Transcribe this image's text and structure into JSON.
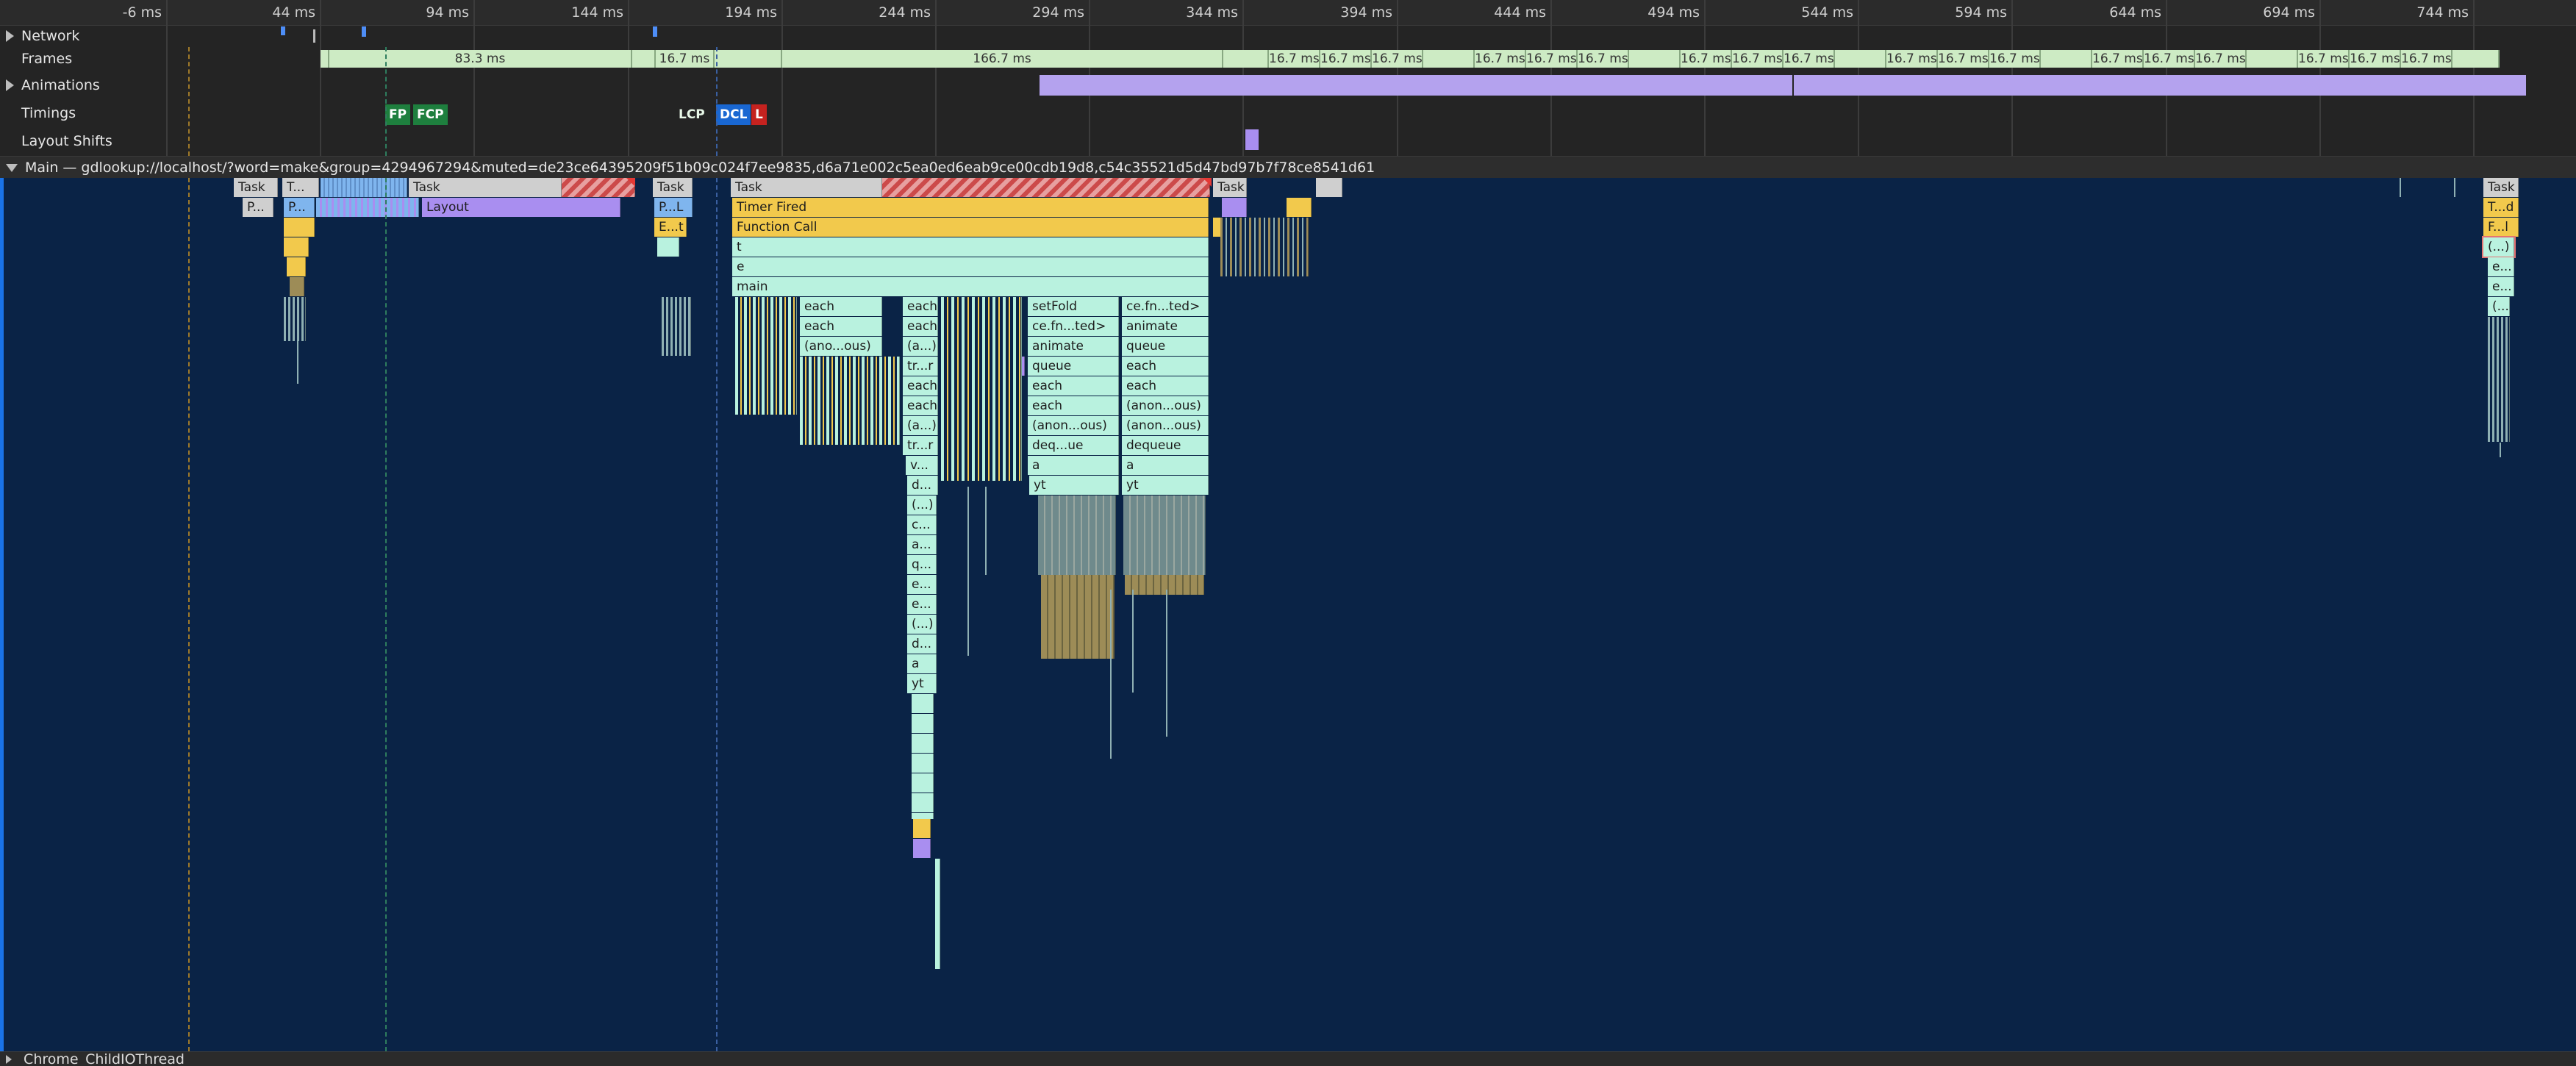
{
  "ruler": {
    "ticks": [
      "-6 ms",
      "44 ms",
      "94 ms",
      "144 ms",
      "194 ms",
      "244 ms",
      "294 ms",
      "344 ms",
      "394 ms",
      "444 ms",
      "494 ms",
      "544 ms",
      "594 ms",
      "644 ms",
      "694 ms",
      "744 ms"
    ]
  },
  "tracks": {
    "network": "Network",
    "frames": "Frames",
    "animations": "Animations",
    "timings": "Timings",
    "layout_shifts": "Layout Shifts"
  },
  "frames": {
    "labels": [
      "83.3 ms",
      "16.7 ms",
      "166.7 ms",
      "16.7 ms",
      "16.7 ms",
      "16.7 ms",
      "16.7 ms",
      "16.7 ms",
      "16.7 ms",
      "16.7 ms",
      "16.7 ms",
      "16.7 ms",
      "16.7 ms",
      "16.7 ms",
      "16.7 ms",
      "16.7 ms",
      "16.7 ms",
      "16.7 ms",
      "16.7 ms",
      "16.7 ms",
      "16.7 ms",
      "16.7 ms"
    ]
  },
  "timings": {
    "fp": "FP",
    "fcp": "FCP",
    "lcp": "LCP",
    "dcl": "DCL",
    "l": "L"
  },
  "main": {
    "title": "Main — gdlookup://localhost/?word=make&group=4294967294&muted=de23ce64395209f51b09c024f7ee9835,d6a71e002c5ea0ed6eab9ce00cdb19d8,c54c35521d5d47bd97b7f78ce8541d61",
    "blocks": {
      "task1": "Task",
      "task2": "T...",
      "task3": "Task",
      "task4": "Task",
      "task5": "Task",
      "task6": "Task",
      "task7": "Task",
      "p1": "P...",
      "p2": "P...",
      "layout": "Layout",
      "pl": "P...L",
      "t_d": "T...d",
      "eval": "E...t",
      "f_l": "F...l",
      "paren1": "(...)",
      "e_a": "e...",
      "e_b": "e...",
      "paren_r": "(...",
      "timer_fired": "Timer Fired",
      "function_call": "Function Call",
      "t": "t",
      "e": "e",
      "main": "main",
      "each1": "each",
      "each2": "each",
      "anon1": "(ano...ous)",
      "col2": [
        "each",
        "each",
        "(a...)",
        "tr...r",
        "each",
        "each",
        "(a...)",
        "tr...r",
        "v...",
        "d...",
        "(...)",
        "c...",
        "a...",
        "q...",
        "e...",
        "e...",
        "(...)",
        "d...",
        "a",
        "yt"
      ],
      "col3": [
        "setFold",
        "ce.fn...ted>",
        "animate",
        "queue",
        "each",
        "each",
        "(anon...ous)",
        "deq...ue",
        "a",
        "yt"
      ],
      "col4": [
        "ce.fn...ted>",
        "animate",
        "queue",
        "each",
        "each",
        "(anon...ous)",
        "dequeue",
        "a",
        "yt"
      ]
    }
  },
  "bottom": {
    "thread": "Chrome_ChildIOThread"
  },
  "colors": {
    "background": "#0a2346",
    "frame": "#cdebc4",
    "animation": "#b4a2ee",
    "task": "#cfcfcf",
    "yellow": "#f2c94c",
    "cyan": "#b9f2df",
    "fp": "#1e7f3e",
    "dcl": "#1967d2",
    "l": "#c5221f"
  }
}
